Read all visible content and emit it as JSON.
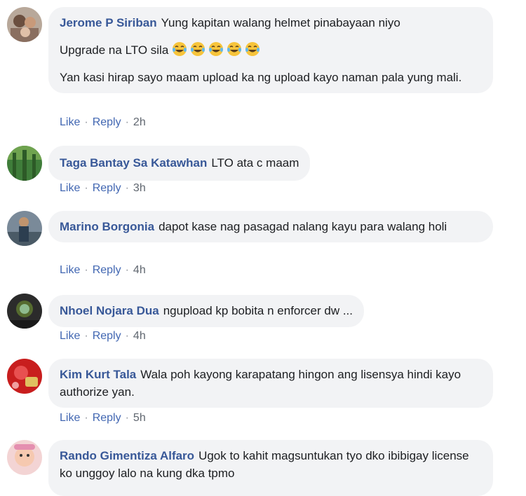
{
  "comments": [
    {
      "author": "Jerome P Siriban",
      "lines": [
        "Yung kapitan walang helmet pinabayaan niyo"
      ],
      "line2": "Upgrade na LTO sila",
      "emoji": "tears-of-joy-emoji",
      "emoji_count": 5,
      "line3": "Yan kasi hirap sayo maam upload ka ng upload kayo naman pala yung mali.",
      "like": "Like",
      "reply": "Reply",
      "time": "2h"
    },
    {
      "author": "Taga Bantay Sa Katawhan",
      "text": "LTO ata c maam",
      "like": "Like",
      "reply": "Reply",
      "time": "3h"
    },
    {
      "author": "Marino Borgonia",
      "text": "dapot kase nag pasagad nalang kayu para walang holi",
      "like": "Like",
      "reply": "Reply",
      "time": "4h"
    },
    {
      "author": "Nhoel Nojara Dua",
      "text": "ngupload kp bobita n enforcer dw ...",
      "like": "Like",
      "reply": "Reply",
      "time": "4h"
    },
    {
      "author": "Kim Kurt Tala",
      "text": "Wala poh kayong karapatang hingon ang lisensya hindi kayo authorize yan.",
      "like": "Like",
      "reply": "Reply",
      "time": "5h"
    },
    {
      "author": "Rando Gimentiza Alfaro",
      "text": "Ugok to kahit magsuntukan tyo dko ibibigay license ko unggoy lalo na kung dka tpmo"
    }
  ],
  "colors": {
    "author": "#385898",
    "link": "#4267b2",
    "meta": "#606770",
    "bubble": "#f2f3f5"
  }
}
